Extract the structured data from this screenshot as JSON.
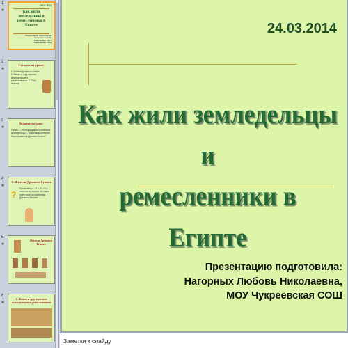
{
  "slide": {
    "date": "24.03.2014",
    "title_line1": "Как жили земледельцы и",
    "title_line2": "ремесленники в Египте",
    "author_line1": "Презентацию подготовила:",
    "author_line2": "Нагорных Любовь Николаевна,",
    "author_line3": "МОУ Чукреевская СОШ"
  },
  "notes": {
    "label": "Заметки к слайду"
  },
  "thumbnails": [
    {
      "num": "1",
      "title": "Как жили земледельцы и ремесленники в Египте",
      "date": "24.03.2014",
      "author": "Презентацию подготовила: Нагорных Любовь Николаевна, МОУ Чукреевская СОШ"
    },
    {
      "num": "2",
      "heading": "Сегодня на уроке:",
      "body": "1. Жители Древнего Египта. 2. Жизнь и труд простых земледельцев и ремесленников. 3. Сбор налогов."
    },
    {
      "num": "3",
      "heading": "Задание на урок:",
      "body": "Узнать: – Что выращивали египетские земледельцы? – Какие виды ремесел были развиты в Древнем Египте?"
    },
    {
      "num": "4",
      "heading": "1. Жители Древнего Египта",
      "body": "Прочитайте с. 37 п. 25-28 и ответьте на вопрос: Из каких групп состоял население Древнего Египта?"
    },
    {
      "num": "5",
      "heading": "Жители Древнего Египта",
      "body": ""
    },
    {
      "num": "6",
      "heading": "2. Жизнь и труд простых земледельцев и ремесленников",
      "body": ""
    }
  ]
}
